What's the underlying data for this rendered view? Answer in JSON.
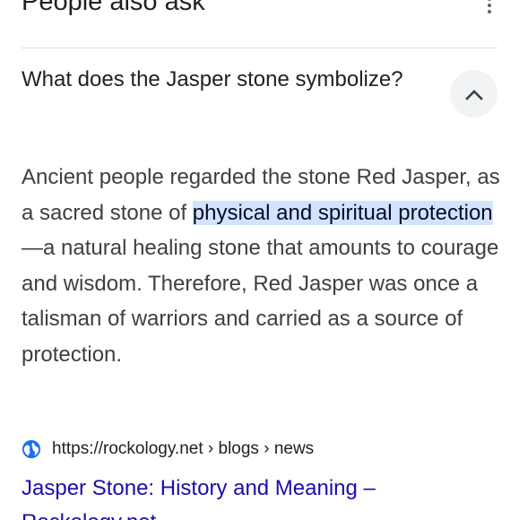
{
  "header": {
    "title": "People also ask"
  },
  "question": {
    "text": "What does the Jasper stone symbolize?"
  },
  "answer": {
    "part1": "Ancient people regarded the stone Red Jasper, as a sacred stone of ",
    "highlight": "physical and spiritual protection",
    "part2": "—a natural healing stone that amounts to courage and wisdom. Therefore, Red Jasper was once a talisman of warriors and carried as a source of protection."
  },
  "source": {
    "url": "https://rockology.net › blogs › news",
    "icon": "globe-icon"
  },
  "result": {
    "title_line1": "Jasper Stone: History and Meaning –",
    "title_line2": "Rockology.net"
  },
  "icons": {
    "more": "more-vert-icon",
    "collapse": "chevron-up-icon"
  },
  "colors": {
    "link": "#1a0dab",
    "highlight_bg": "#d3e3fd",
    "icon_blue": "#1a73e8"
  }
}
